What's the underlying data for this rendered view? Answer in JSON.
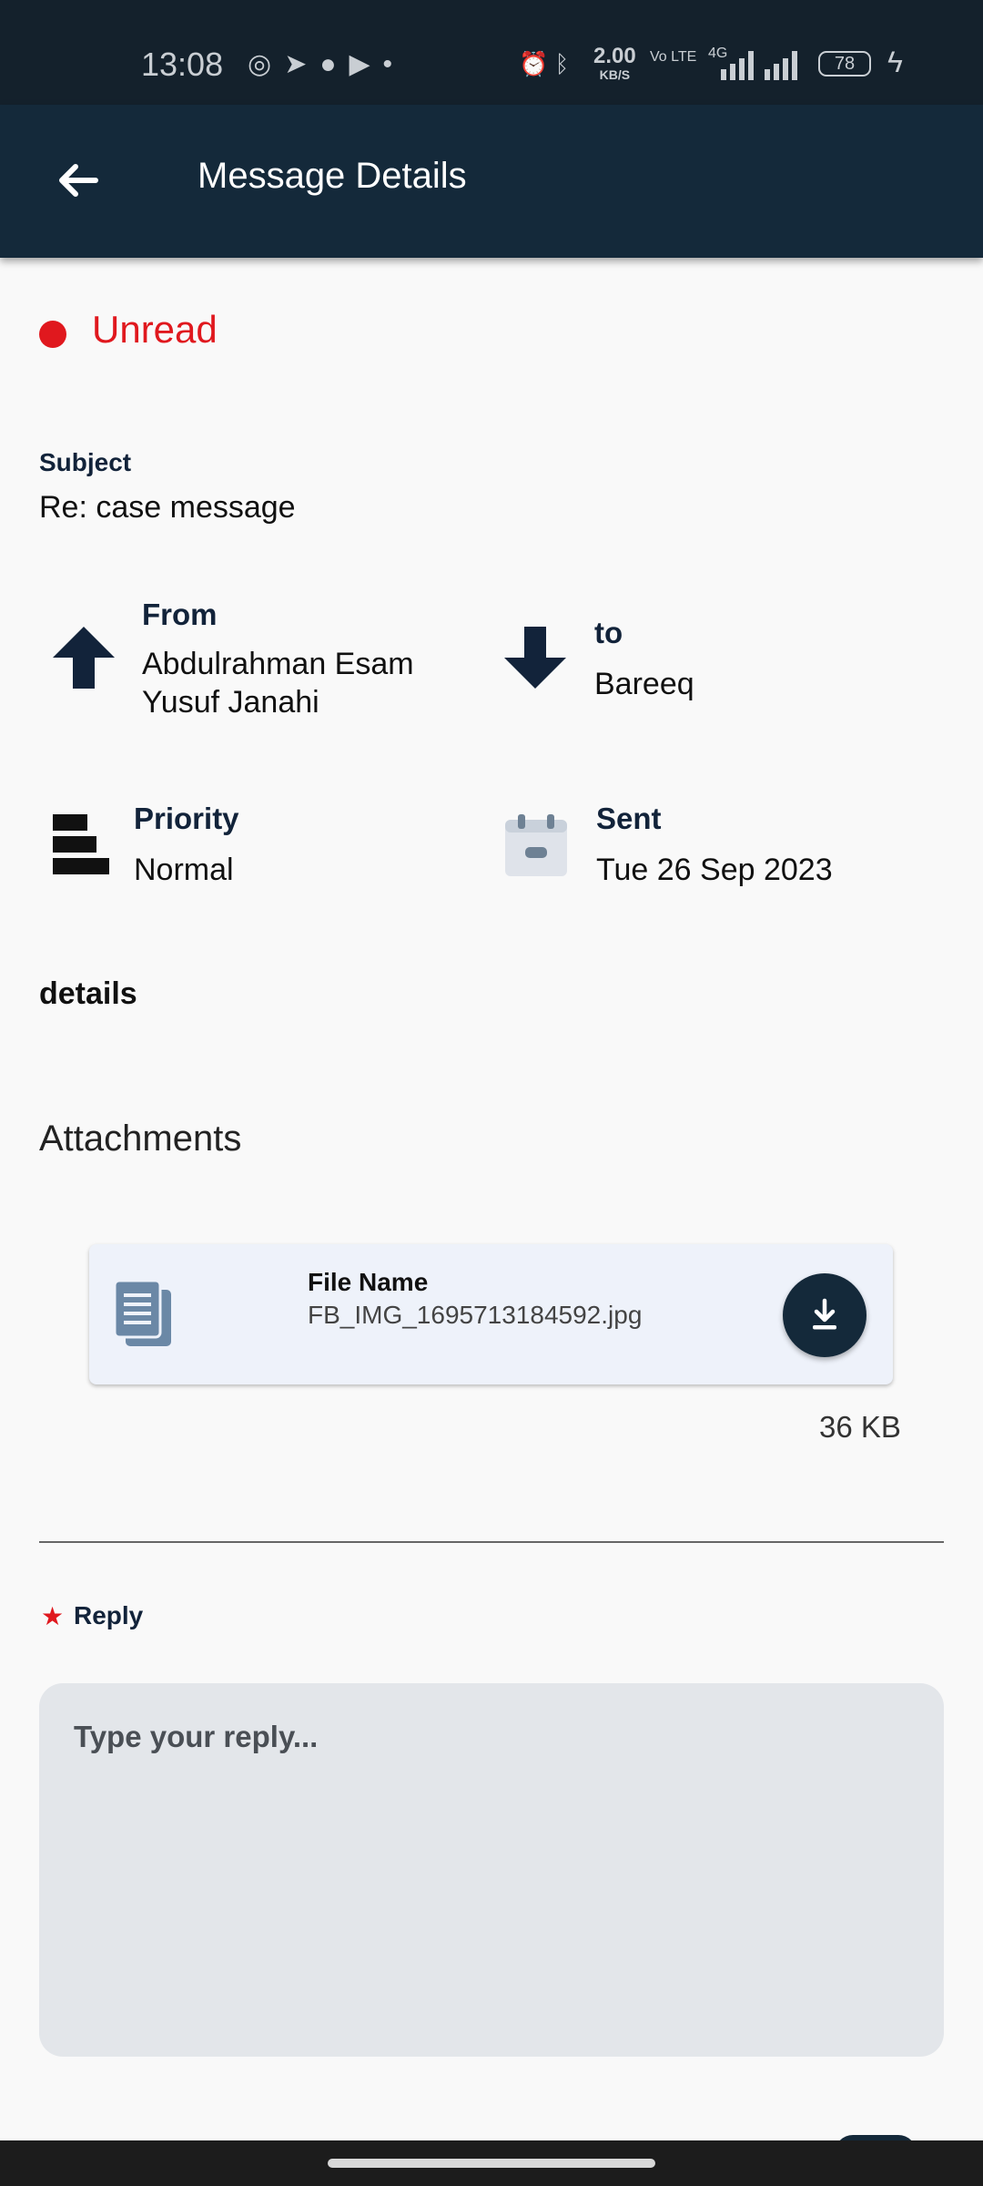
{
  "status_bar": {
    "time": "13:08",
    "net_speed": "2.00",
    "net_speed_unit": "KB/S",
    "volte": "Vo LTE",
    "network": "4G",
    "battery": "78",
    "app_icons": [
      "whatsapp-icon",
      "telegram-icon",
      "chat-icon",
      "youtube-icon",
      "dot-icon"
    ]
  },
  "app_bar": {
    "title": "Message Details"
  },
  "message": {
    "status": "Unread",
    "subject_label": "Subject",
    "subject": "Re: case message",
    "from_label": "From",
    "from_line1": "Abdulrahman Esam",
    "from_line2": "Yusuf Janahi",
    "to_label": "to",
    "to": "Bareeq",
    "priority_label": "Priority",
    "priority": "Normal",
    "sent_label": "Sent",
    "sent": "Tue 26 Sep 2023",
    "details_label": "details"
  },
  "attachments": {
    "title": "Attachments",
    "items": [
      {
        "name_label": "File Name",
        "name": "FB_IMG_1695713184592.jpg",
        "size": "36 KB"
      }
    ]
  },
  "reply": {
    "required_marker": "★",
    "label": "Reply",
    "placeholder": "Type your reply..."
  },
  "colors": {
    "primary": "#14293a",
    "unread": "#e0181e",
    "card": "#eef2fa",
    "reply_bg": "#e3e6ea"
  }
}
